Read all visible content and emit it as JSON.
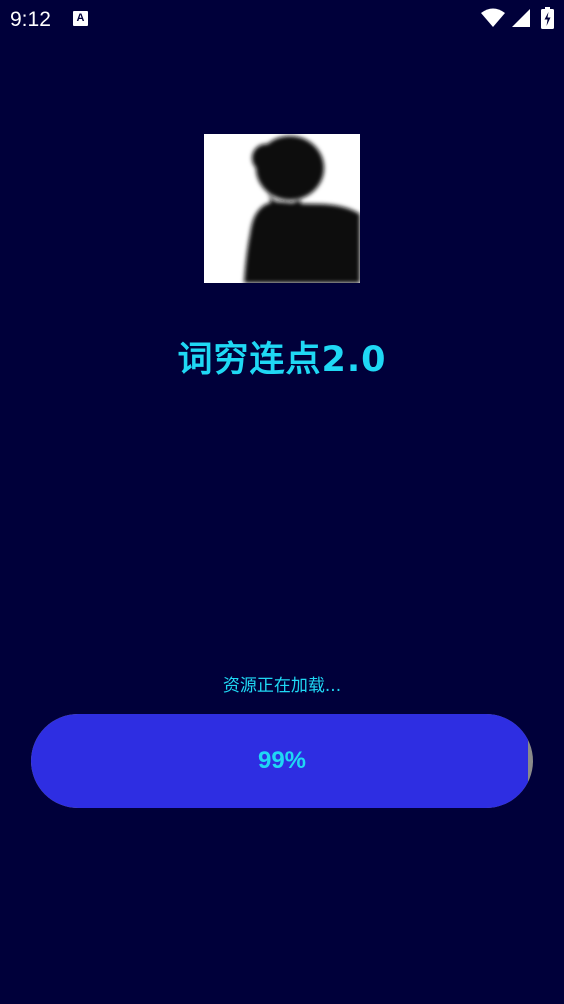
{
  "status_bar": {
    "time": "9:12",
    "notification_icon": "a-icon",
    "icons": [
      "wifi-icon",
      "signal-icon",
      "battery-icon"
    ]
  },
  "splash": {
    "avatar": "silhouette-avatar",
    "title": "词穷连点2.0",
    "loading_text": "资源正在加载...",
    "progress": {
      "value": 0.99,
      "label": "99%"
    }
  },
  "colors": {
    "background": "#00003a",
    "accent_text": "#1fd8f4",
    "progress_fill": "#2e2ee2",
    "progress_track": "#8a8a8a"
  }
}
